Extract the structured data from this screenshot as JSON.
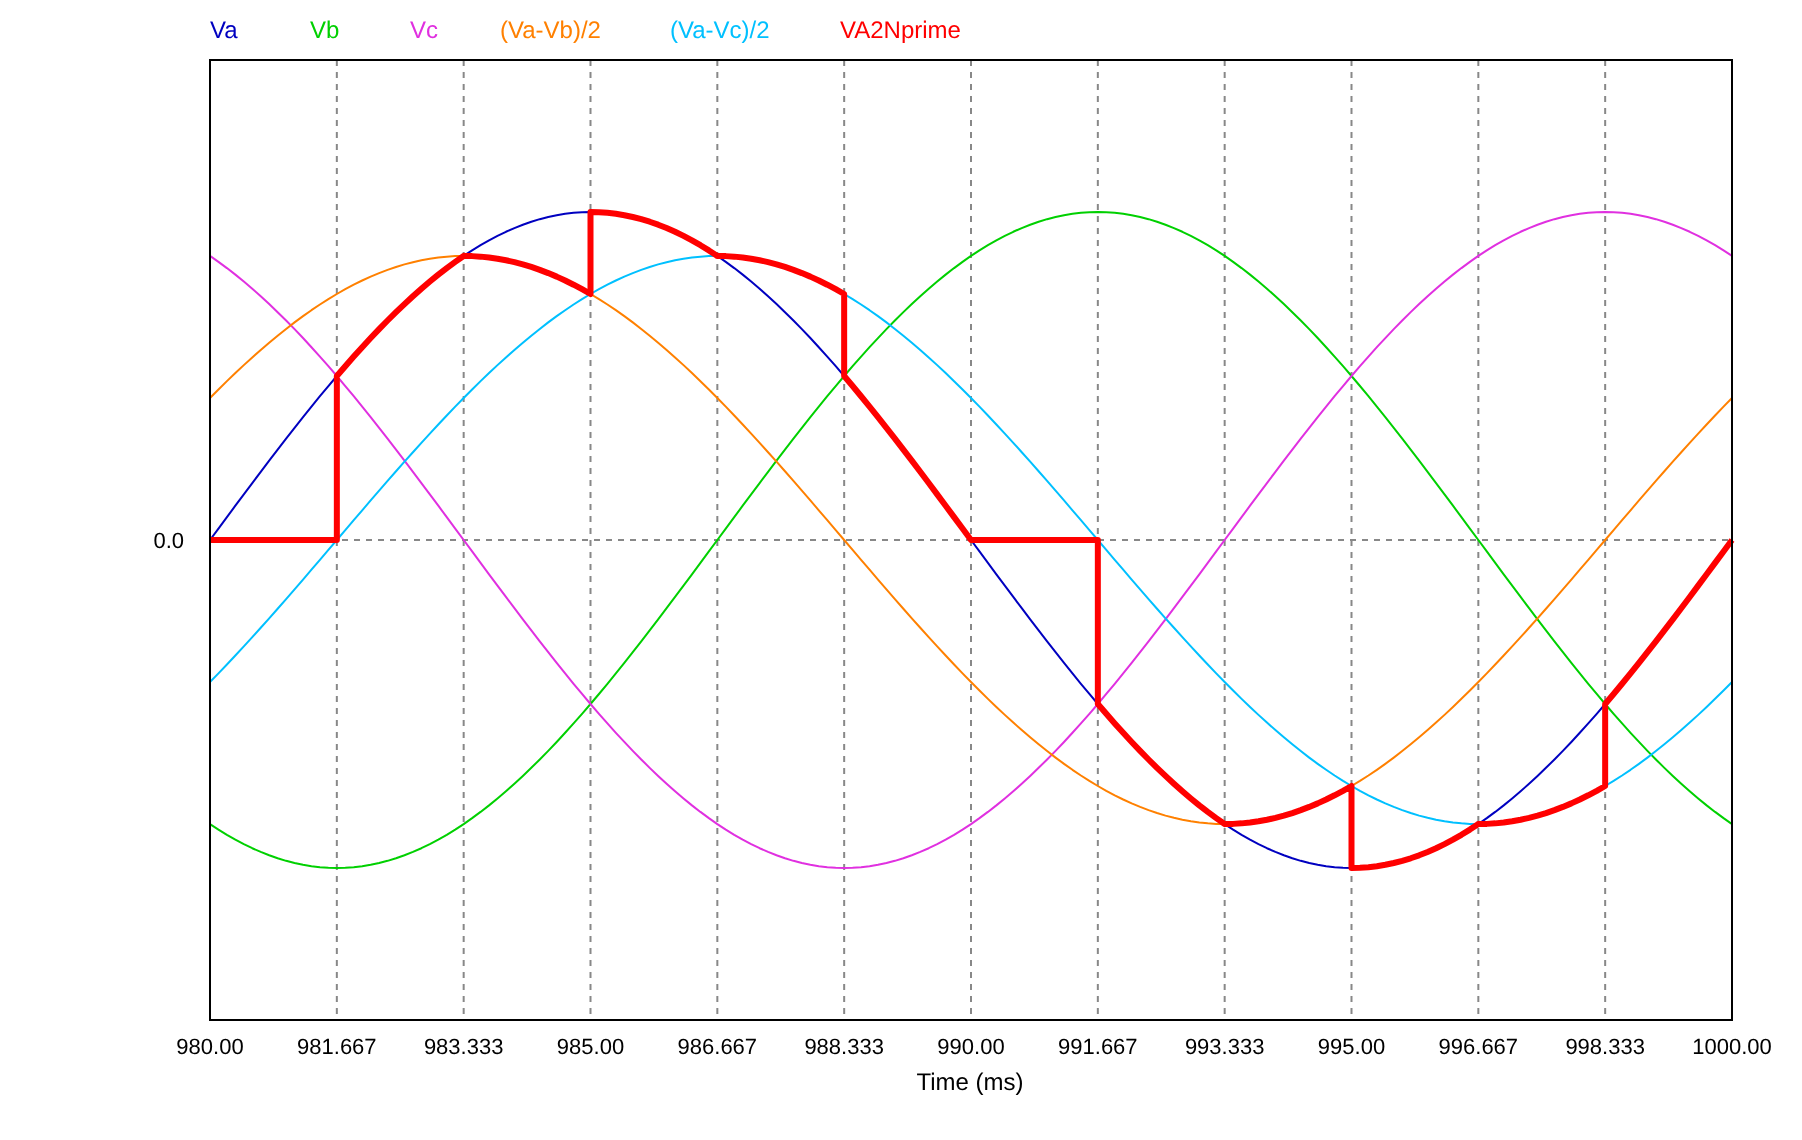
{
  "legend": [
    {
      "label": "Va",
      "color": "#0000c0"
    },
    {
      "label": "Vb",
      "color": "#00d000"
    },
    {
      "label": "Vc",
      "color": "#e030e0"
    },
    {
      "label": "(Va-Vb)/2",
      "color": "#ff8000"
    },
    {
      "label": "(Va-Vc)/2",
      "color": "#00c0ff"
    },
    {
      "label": "VA2Nprime",
      "color": "#ff0000"
    }
  ],
  "x_axis": {
    "title": "Time (ms)",
    "ticks": [
      "980.00",
      "981.667",
      "983.333",
      "985.00",
      "986.667",
      "988.333",
      "990.00",
      "991.667",
      "993.333",
      "995.00",
      "996.667",
      "998.333",
      "1000.00"
    ]
  },
  "y_axis": {
    "ticks": [
      "0.0"
    ]
  }
}
